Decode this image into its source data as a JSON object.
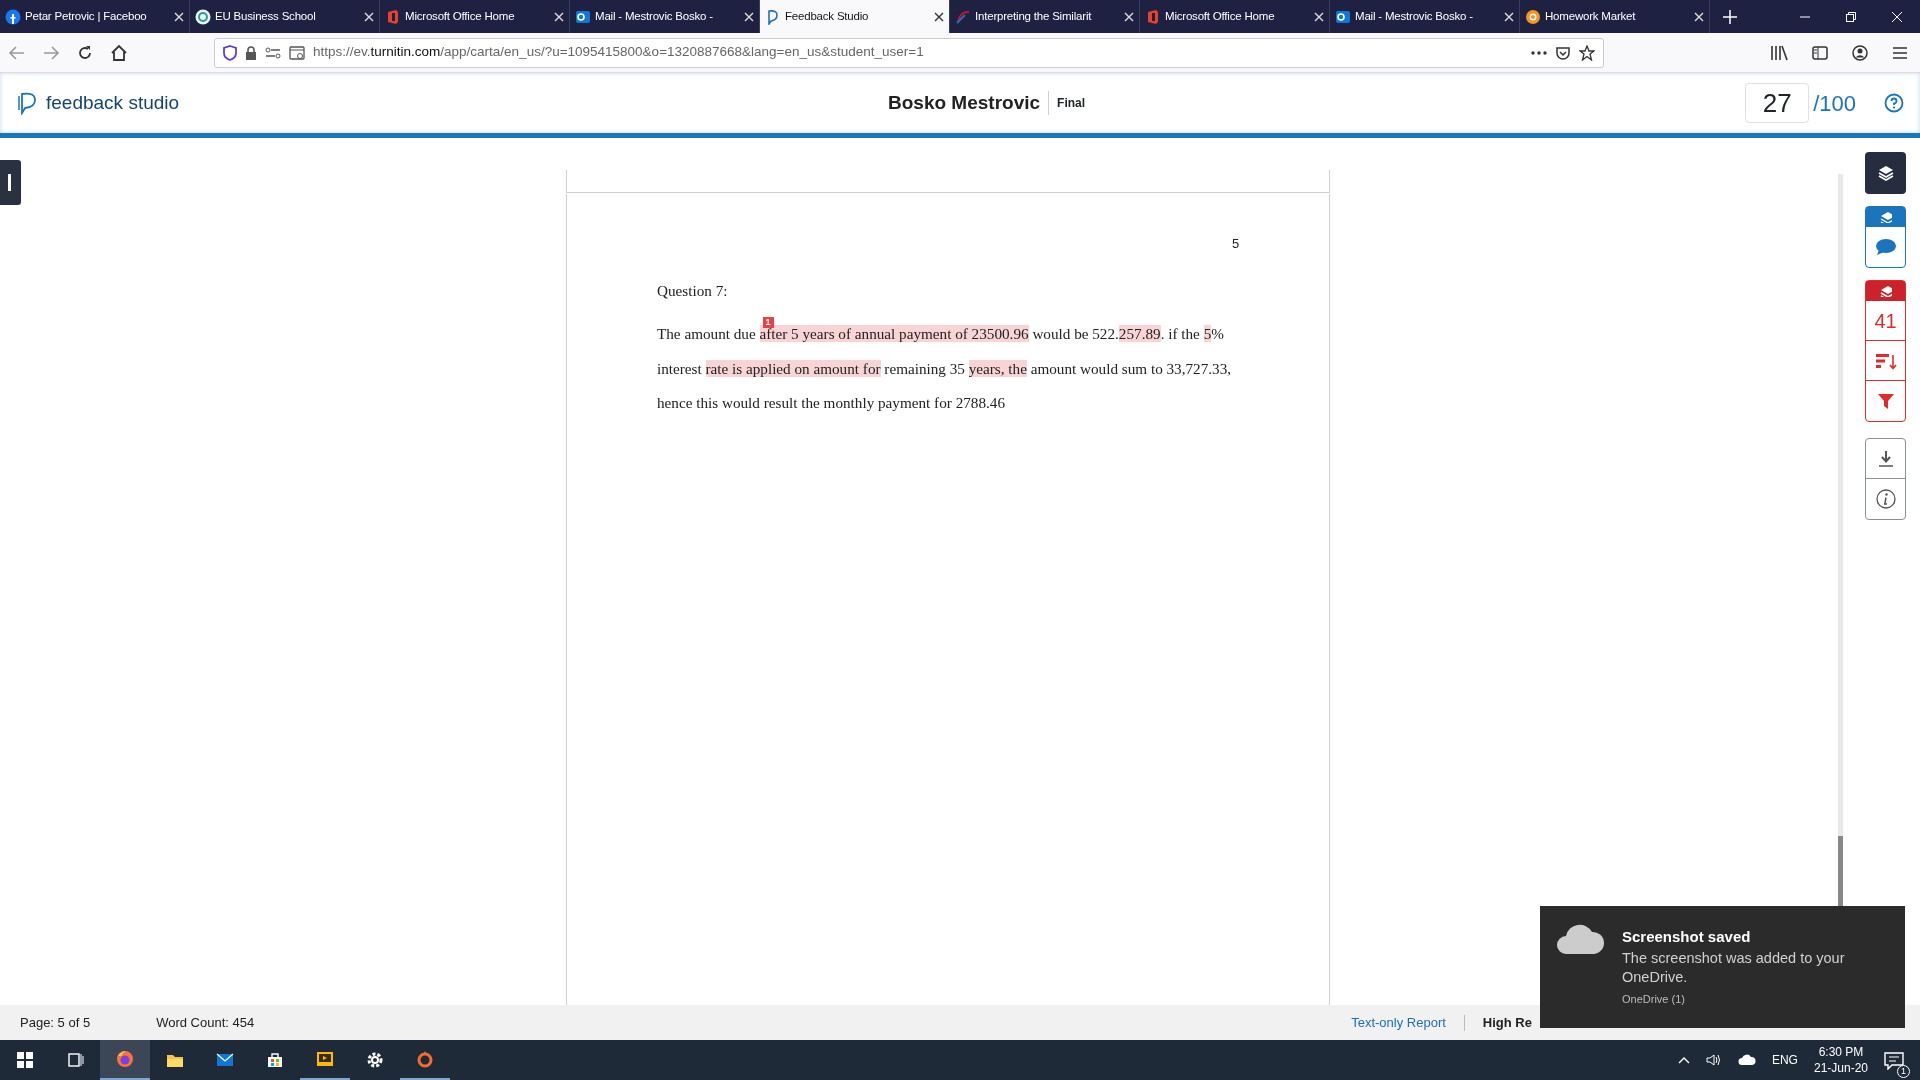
{
  "browser": {
    "tabs": [
      {
        "title": "Petar Petrovic | Faceboo",
        "selected": false
      },
      {
        "title": "EU Business School",
        "selected": false
      },
      {
        "title": "Microsoft Office Home",
        "selected": false
      },
      {
        "title": "Mail - Mestrovic Bosko -",
        "selected": false
      },
      {
        "title": "Feedback Studio",
        "selected": true
      },
      {
        "title": "Interpreting the Similarit",
        "selected": false
      },
      {
        "title": "Microsoft Office Home",
        "selected": false
      },
      {
        "title": "Mail - Mestrovic Bosko -",
        "selected": false
      },
      {
        "title": "Homework Market",
        "selected": false
      }
    ],
    "url": {
      "scheme": "https://ev.",
      "host": "turnitin.com",
      "path": "/app/carta/en_us/?u=1095415800&o=1320887668&lang=en_us&student_user=1"
    }
  },
  "header": {
    "logo": "feedback studio",
    "student": "Bosko Mestrovic",
    "status": "Final",
    "score": "27",
    "out_of": "/100"
  },
  "document": {
    "page_number": "5",
    "heading": "Question 7:",
    "match_marker": "1",
    "lines": [
      [
        {
          "text": "The amount due ",
          "highlighted": false
        },
        {
          "text": "after 5 years of annual payment of 23500.96",
          "highlighted": true
        },
        {
          "text": " would be 522.",
          "highlighted": false
        },
        {
          "text": "257.89",
          "highlighted": true
        },
        {
          "text": ". if the ",
          "highlighted": false
        },
        {
          "text": "5",
          "highlighted": true
        },
        {
          "text": "%",
          "highlighted": false
        }
      ],
      [
        {
          "text": "interest ",
          "highlighted": false
        },
        {
          "text": "rate is applied on amount for",
          "highlighted": true
        },
        {
          "text": " remaining 35 ",
          "highlighted": false
        },
        {
          "text": "years, the",
          "highlighted": true
        },
        {
          "text": " amount would sum to 33,727.33,",
          "highlighted": false
        }
      ],
      [
        {
          "text": "hence this would result the monthly payment for 2788.46",
          "highlighted": false
        }
      ]
    ]
  },
  "sidebar": {
    "match_count": "41"
  },
  "status_bar": {
    "page": "Page: 5 of 5",
    "word_count": "Word Count: 454",
    "text_only": "Text-only Report",
    "high_res": "High Re"
  },
  "notification": {
    "title": "Screenshot saved",
    "body": "The screenshot was added to your OneDrive.",
    "source": "OneDrive (1)"
  },
  "taskbar": {
    "language": "ENG",
    "time": "6:30 PM",
    "date": "21-Jun-20",
    "notification_count": "1"
  }
}
